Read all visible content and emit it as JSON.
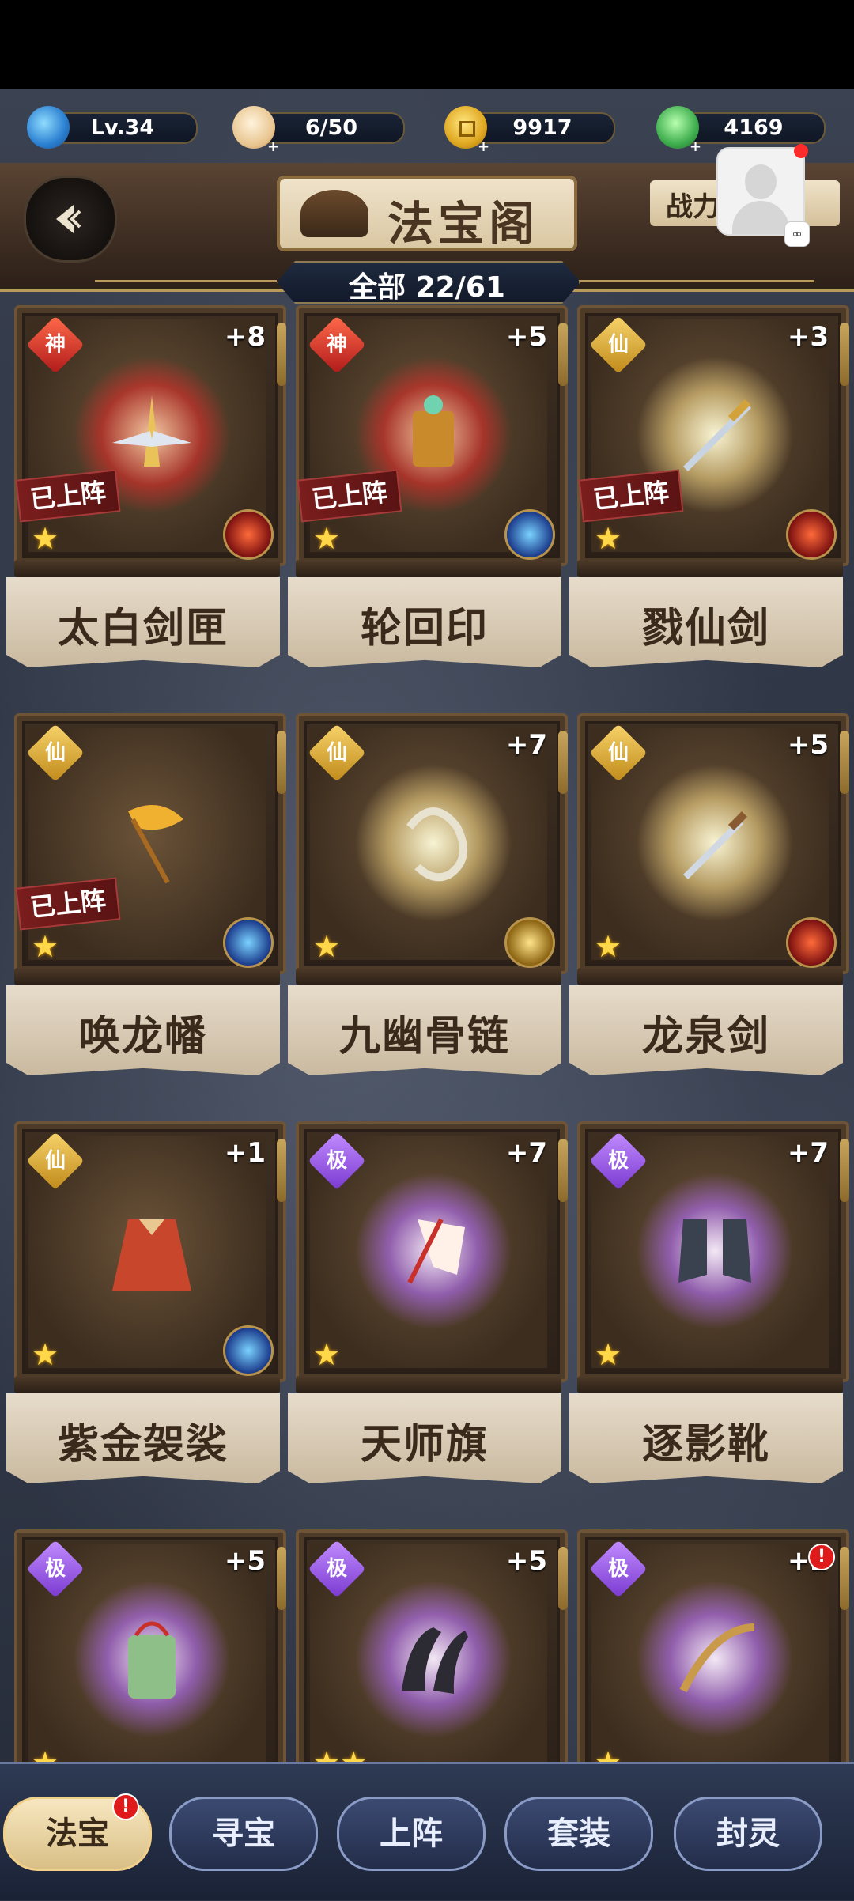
{
  "resources": {
    "level": "Lv.34",
    "stamina": "6/50",
    "coins": "9917",
    "jade": "4169"
  },
  "header": {
    "title": "法宝阁",
    "power_label": "战力",
    "count": "全部 22/61"
  },
  "treasures": [
    {
      "name": "太白剑匣",
      "grade": "神",
      "level": "+8",
      "deployed": "已上阵",
      "stars": "★",
      "glow": "red"
    },
    {
      "name": "轮回印",
      "grade": "神",
      "level": "+5",
      "deployed": "已上阵",
      "stars": "★",
      "glow": "red"
    },
    {
      "name": "戮仙剑",
      "grade": "仙",
      "level": "+3",
      "deployed": "已上阵",
      "stars": "★",
      "glow": "gold"
    },
    {
      "name": "唤龙幡",
      "grade": "仙",
      "level": "",
      "deployed": "已上阵",
      "stars": "★",
      "glow": "none"
    },
    {
      "name": "九幽骨链",
      "grade": "仙",
      "level": "+7",
      "deployed": "",
      "stars": "★",
      "glow": "gold"
    },
    {
      "name": "龙泉剑",
      "grade": "仙",
      "level": "+5",
      "deployed": "",
      "stars": "★",
      "glow": "gold"
    },
    {
      "name": "紫金袈裟",
      "grade": "仙",
      "level": "+1",
      "deployed": "",
      "stars": "★",
      "glow": "none"
    },
    {
      "name": "天师旗",
      "grade": "极",
      "level": "+7",
      "deployed": "",
      "stars": "★",
      "glow": "purple"
    },
    {
      "name": "逐影靴",
      "grade": "极",
      "level": "+7",
      "deployed": "",
      "stars": "★",
      "glow": "purple"
    },
    {
      "name": "",
      "grade": "极",
      "level": "+5",
      "deployed": "",
      "stars": "★",
      "glow": "purple"
    },
    {
      "name": "",
      "grade": "极",
      "level": "+5",
      "deployed": "",
      "stars": "★★",
      "glow": "purple"
    },
    {
      "name": "",
      "grade": "极",
      "level": "+2",
      "deployed": "",
      "stars": "★",
      "glow": "purple"
    }
  ],
  "tabs": [
    {
      "label": "法宝",
      "active": true,
      "alert": "!"
    },
    {
      "label": "寻宝"
    },
    {
      "label": "上阵"
    },
    {
      "label": "套装"
    },
    {
      "label": "封灵"
    }
  ],
  "colors": {
    "grade_shen": "#c0201a",
    "grade_xian": "#d9a02a",
    "grade_ji": "#8a4ad8",
    "star": "#ffd84a"
  }
}
